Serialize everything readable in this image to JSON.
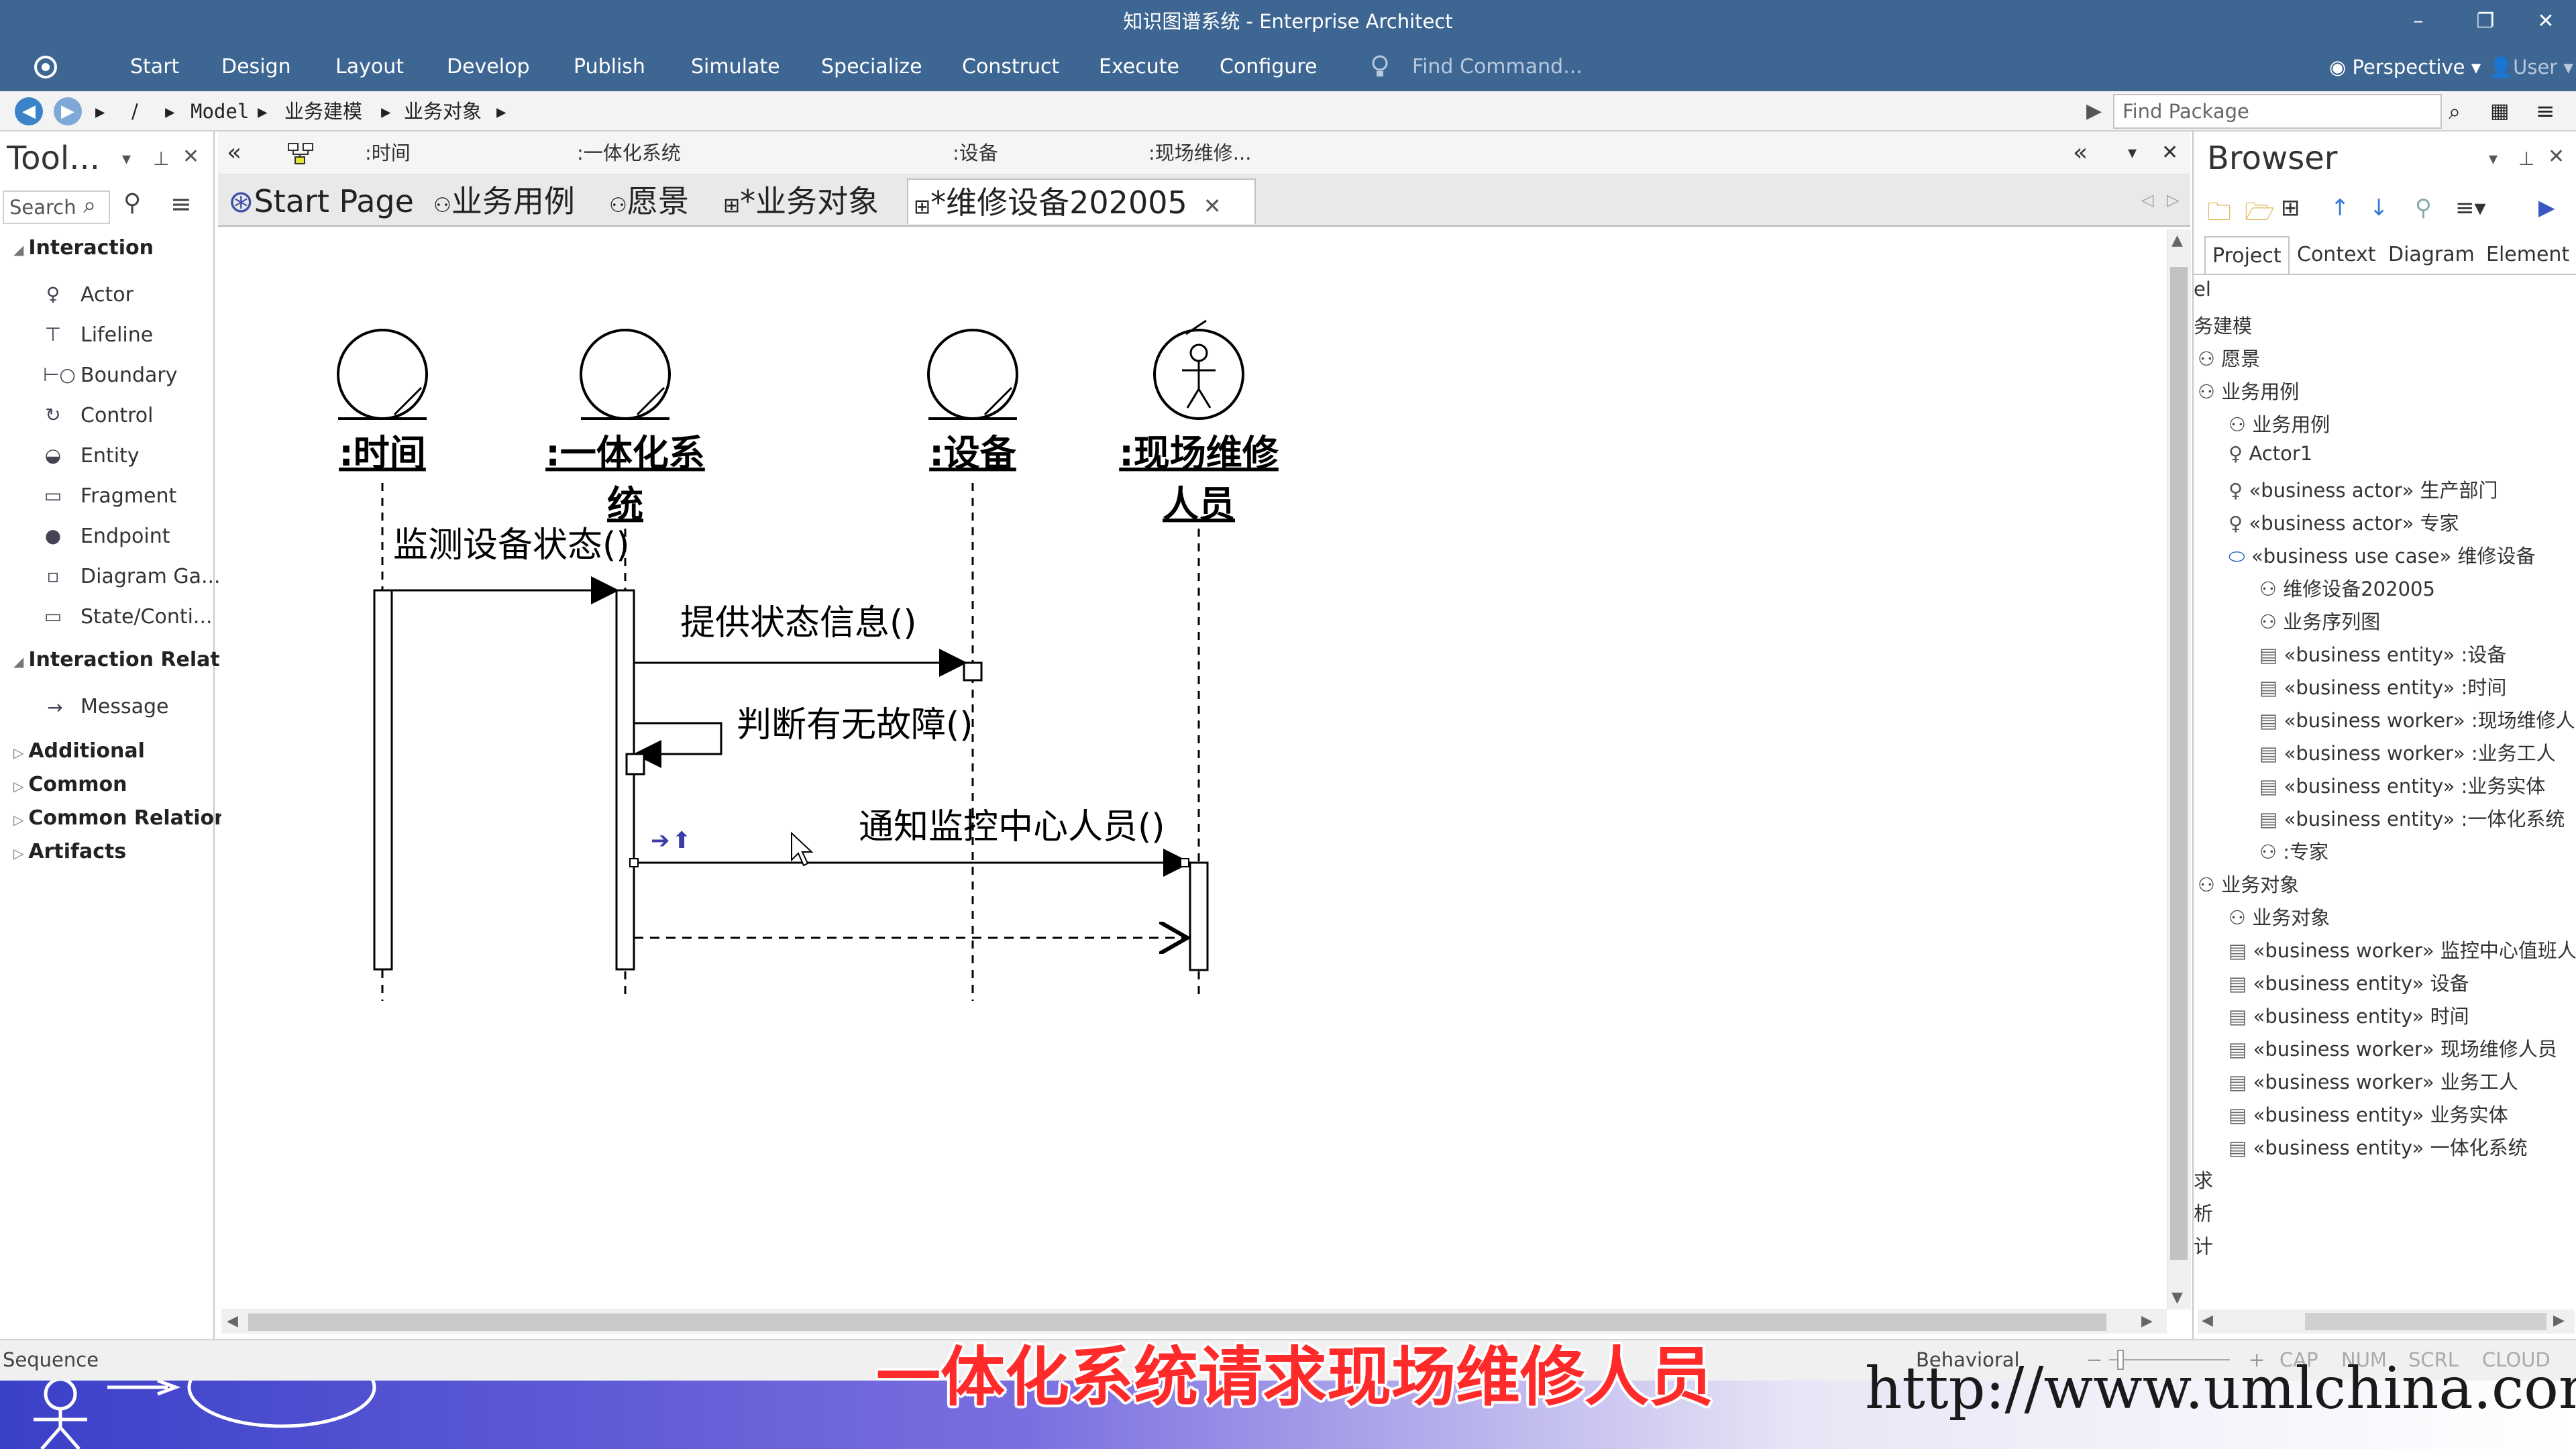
{
  "window": {
    "title": "知识图谱系统 - Enterprise Architect",
    "controls": [
      "–",
      "❐",
      "✕"
    ]
  },
  "menu": {
    "items": [
      "Start",
      "Design",
      "Layout",
      "Develop",
      "Publish",
      "Simulate",
      "Specialize",
      "Construct",
      "Execute",
      "Configure"
    ],
    "find_command": "Find Command...",
    "perspective": "Perspective",
    "user": "User"
  },
  "nav": {
    "path": [
      "/",
      "Model",
      "业务建模",
      "业务对象"
    ],
    "find_package": "Find Package"
  },
  "toolbox": {
    "title": "Tool...",
    "search": "Search",
    "sections": [
      {
        "name": "Interaction",
        "items": [
          "Actor",
          "Lifeline",
          "Boundary",
          "Control",
          "Entity",
          "Fragment",
          "Endpoint",
          "Diagram Ga...",
          "State/Conti..."
        ]
      },
      {
        "name": "Interaction Relatio",
        "items": [
          "Message"
        ]
      },
      {
        "name": "Additional",
        "items": []
      },
      {
        "name": "Common",
        "items": []
      },
      {
        "name": "Common Relations",
        "items": []
      },
      {
        "name": "Artifacts",
        "items": []
      }
    ]
  },
  "diagram_header": [
    ":时间",
    ":一体化系统",
    ":设备",
    ":现场维修..."
  ],
  "tabs": [
    "Start Page",
    "业务用例",
    "愿景",
    "*业务对象",
    "*维修设备202005"
  ],
  "diagram": {
    "lifelines": [
      ":时间",
      ":一体化系统",
      ":设备",
      ":现场维修人员"
    ],
    "lifeline_labels": [
      [
        ":时间"
      ],
      [
        ":一体化系",
        "统"
      ],
      [
        ":设备"
      ],
      [
        ":现场维修",
        "人员"
      ]
    ],
    "messages": [
      "监测设备状态()",
      "提供状态信息()",
      "判断有无故障()",
      "通知监控中心人员()"
    ]
  },
  "browser": {
    "title": "Browser",
    "tabs": [
      "Project",
      "Context",
      "Diagram",
      "Element"
    ],
    "tree": [
      {
        "t": "el",
        "i": 0
      },
      {
        "t": "务建模",
        "i": 0
      },
      {
        "t": "愿景",
        "i": 1
      },
      {
        "t": "业务用例",
        "i": 1
      },
      {
        "t": "业务用例",
        "i": 2
      },
      {
        "t": "Actor1",
        "i": 2
      },
      {
        "t": "«business actor» 生产部门",
        "i": 2
      },
      {
        "t": "«business actor» 专家",
        "i": 2
      },
      {
        "t": "«business use case» 维修设备",
        "i": 2
      },
      {
        "t": "维修设备202005",
        "i": 3
      },
      {
        "t": "业务序列图",
        "i": 3
      },
      {
        "t": "«business entity» :设备",
        "i": 3
      },
      {
        "t": "«business entity» :时间",
        "i": 3
      },
      {
        "t": "«business worker» :现场维修人",
        "i": 3
      },
      {
        "t": "«business worker» :业务工人",
        "i": 3
      },
      {
        "t": "«business entity» :业务实体",
        "i": 3
      },
      {
        "t": "«business entity» :一体化系统",
        "i": 3
      },
      {
        "t": ":专家",
        "i": 3
      },
      {
        "t": "业务对象",
        "i": 1
      },
      {
        "t": "业务对象",
        "i": 2
      },
      {
        "t": "«business worker» 监控中心值班人",
        "i": 2
      },
      {
        "t": "«business entity» 设备",
        "i": 2
      },
      {
        "t": "«business entity» 时间",
        "i": 2
      },
      {
        "t": "«business worker» 现场维修人员",
        "i": 2
      },
      {
        "t": "«business worker» 业务工人",
        "i": 2
      },
      {
        "t": "«business entity» 业务实体",
        "i": 2
      },
      {
        "t": "«business entity» 一体化系统",
        "i": 2
      },
      {
        "t": "求",
        "i": 0
      },
      {
        "t": "析",
        "i": 0
      },
      {
        "t": "计",
        "i": 0
      }
    ]
  },
  "status": {
    "left": "Sequence",
    "mode": "Behavioral",
    "indicators": [
      "CAP",
      "NUM",
      "SCRL",
      "CLOUD"
    ]
  },
  "subtitle": "一体化系统请求现场维修人员",
  "watermark": "http://www.umlchina.com"
}
